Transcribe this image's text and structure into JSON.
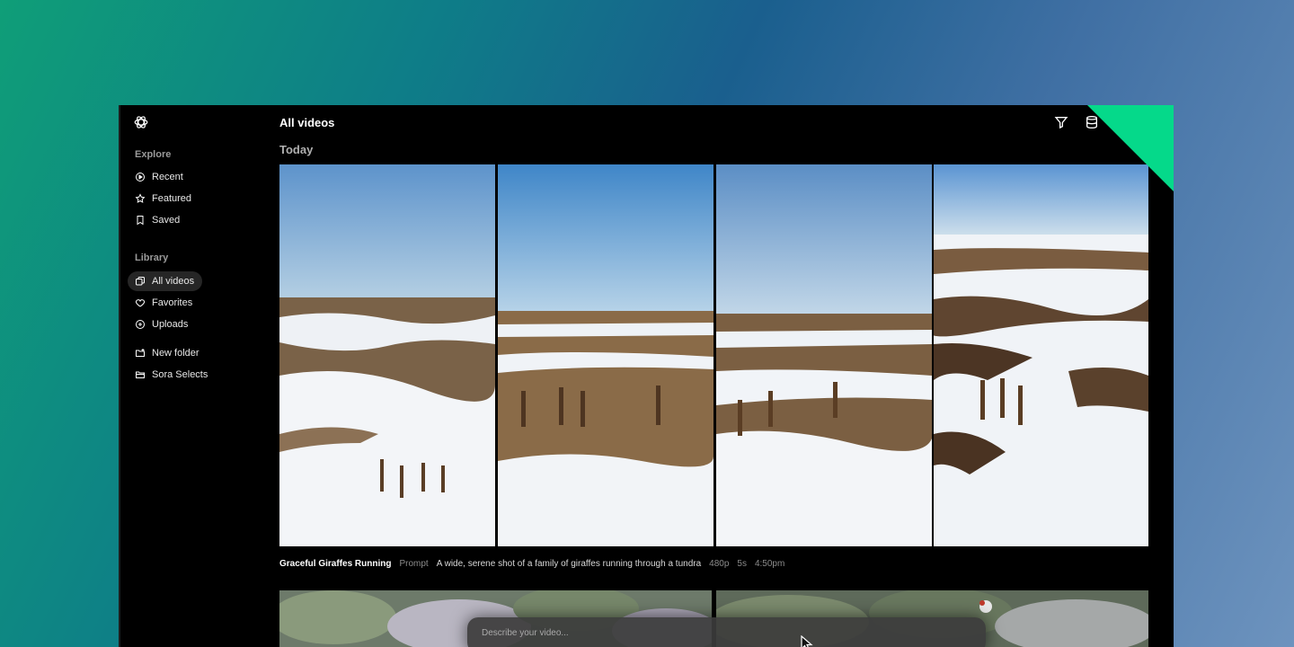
{
  "header": {
    "title": "All videos"
  },
  "sidebar": {
    "explore_label": "Explore",
    "explore_items": [
      {
        "label": "Recent",
        "icon": "play-circle-icon"
      },
      {
        "label": "Featured",
        "icon": "star-icon"
      },
      {
        "label": "Saved",
        "icon": "bookmark-icon"
      }
    ],
    "library_label": "Library",
    "library_items": [
      {
        "label": "All videos",
        "icon": "layers-icon",
        "active": true
      },
      {
        "label": "Favorites",
        "icon": "heart-icon"
      },
      {
        "label": "Uploads",
        "icon": "plus-circle-icon"
      }
    ],
    "folder_items": [
      {
        "label": "New folder",
        "icon": "folder-plus-icon"
      },
      {
        "label": "Sora Selects",
        "icon": "folder-icon"
      }
    ]
  },
  "main": {
    "date_group": "Today",
    "video": {
      "title": "Graceful Giraffes Running",
      "prompt_label": "Prompt",
      "prompt": "A wide, serene shot of a family of giraffes running through a tundra",
      "resolution": "480p",
      "duration": "5s",
      "time": "4:50pm"
    }
  },
  "prompt_bar": {
    "placeholder": "Describe your video..."
  },
  "colors": {
    "accent": "#05d98a",
    "background": "#000000"
  }
}
